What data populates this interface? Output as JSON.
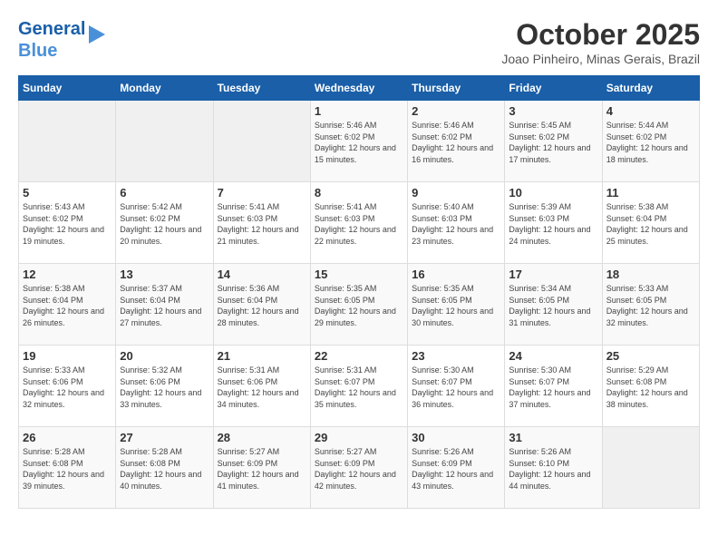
{
  "header": {
    "logo_line1": "General",
    "logo_line2": "Blue",
    "month_title": "October 2025",
    "location": "Joao Pinheiro, Minas Gerais, Brazil"
  },
  "days_of_week": [
    "Sunday",
    "Monday",
    "Tuesday",
    "Wednesday",
    "Thursday",
    "Friday",
    "Saturday"
  ],
  "weeks": [
    [
      {
        "day": "",
        "info": ""
      },
      {
        "day": "",
        "info": ""
      },
      {
        "day": "",
        "info": ""
      },
      {
        "day": "1",
        "info": "Sunrise: 5:46 AM\nSunset: 6:02 PM\nDaylight: 12 hours and 15 minutes."
      },
      {
        "day": "2",
        "info": "Sunrise: 5:46 AM\nSunset: 6:02 PM\nDaylight: 12 hours and 16 minutes."
      },
      {
        "day": "3",
        "info": "Sunrise: 5:45 AM\nSunset: 6:02 PM\nDaylight: 12 hours and 17 minutes."
      },
      {
        "day": "4",
        "info": "Sunrise: 5:44 AM\nSunset: 6:02 PM\nDaylight: 12 hours and 18 minutes."
      }
    ],
    [
      {
        "day": "5",
        "info": "Sunrise: 5:43 AM\nSunset: 6:02 PM\nDaylight: 12 hours and 19 minutes."
      },
      {
        "day": "6",
        "info": "Sunrise: 5:42 AM\nSunset: 6:02 PM\nDaylight: 12 hours and 20 minutes."
      },
      {
        "day": "7",
        "info": "Sunrise: 5:41 AM\nSunset: 6:03 PM\nDaylight: 12 hours and 21 minutes."
      },
      {
        "day": "8",
        "info": "Sunrise: 5:41 AM\nSunset: 6:03 PM\nDaylight: 12 hours and 22 minutes."
      },
      {
        "day": "9",
        "info": "Sunrise: 5:40 AM\nSunset: 6:03 PM\nDaylight: 12 hours and 23 minutes."
      },
      {
        "day": "10",
        "info": "Sunrise: 5:39 AM\nSunset: 6:03 PM\nDaylight: 12 hours and 24 minutes."
      },
      {
        "day": "11",
        "info": "Sunrise: 5:38 AM\nSunset: 6:04 PM\nDaylight: 12 hours and 25 minutes."
      }
    ],
    [
      {
        "day": "12",
        "info": "Sunrise: 5:38 AM\nSunset: 6:04 PM\nDaylight: 12 hours and 26 minutes."
      },
      {
        "day": "13",
        "info": "Sunrise: 5:37 AM\nSunset: 6:04 PM\nDaylight: 12 hours and 27 minutes."
      },
      {
        "day": "14",
        "info": "Sunrise: 5:36 AM\nSunset: 6:04 PM\nDaylight: 12 hours and 28 minutes."
      },
      {
        "day": "15",
        "info": "Sunrise: 5:35 AM\nSunset: 6:05 PM\nDaylight: 12 hours and 29 minutes."
      },
      {
        "day": "16",
        "info": "Sunrise: 5:35 AM\nSunset: 6:05 PM\nDaylight: 12 hours and 30 minutes."
      },
      {
        "day": "17",
        "info": "Sunrise: 5:34 AM\nSunset: 6:05 PM\nDaylight: 12 hours and 31 minutes."
      },
      {
        "day": "18",
        "info": "Sunrise: 5:33 AM\nSunset: 6:05 PM\nDaylight: 12 hours and 32 minutes."
      }
    ],
    [
      {
        "day": "19",
        "info": "Sunrise: 5:33 AM\nSunset: 6:06 PM\nDaylight: 12 hours and 32 minutes."
      },
      {
        "day": "20",
        "info": "Sunrise: 5:32 AM\nSunset: 6:06 PM\nDaylight: 12 hours and 33 minutes."
      },
      {
        "day": "21",
        "info": "Sunrise: 5:31 AM\nSunset: 6:06 PM\nDaylight: 12 hours and 34 minutes."
      },
      {
        "day": "22",
        "info": "Sunrise: 5:31 AM\nSunset: 6:07 PM\nDaylight: 12 hours and 35 minutes."
      },
      {
        "day": "23",
        "info": "Sunrise: 5:30 AM\nSunset: 6:07 PM\nDaylight: 12 hours and 36 minutes."
      },
      {
        "day": "24",
        "info": "Sunrise: 5:30 AM\nSunset: 6:07 PM\nDaylight: 12 hours and 37 minutes."
      },
      {
        "day": "25",
        "info": "Sunrise: 5:29 AM\nSunset: 6:08 PM\nDaylight: 12 hours and 38 minutes."
      }
    ],
    [
      {
        "day": "26",
        "info": "Sunrise: 5:28 AM\nSunset: 6:08 PM\nDaylight: 12 hours and 39 minutes."
      },
      {
        "day": "27",
        "info": "Sunrise: 5:28 AM\nSunset: 6:08 PM\nDaylight: 12 hours and 40 minutes."
      },
      {
        "day": "28",
        "info": "Sunrise: 5:27 AM\nSunset: 6:09 PM\nDaylight: 12 hours and 41 minutes."
      },
      {
        "day": "29",
        "info": "Sunrise: 5:27 AM\nSunset: 6:09 PM\nDaylight: 12 hours and 42 minutes."
      },
      {
        "day": "30",
        "info": "Sunrise: 5:26 AM\nSunset: 6:09 PM\nDaylight: 12 hours and 43 minutes."
      },
      {
        "day": "31",
        "info": "Sunrise: 5:26 AM\nSunset: 6:10 PM\nDaylight: 12 hours and 44 minutes."
      },
      {
        "day": "",
        "info": ""
      }
    ]
  ]
}
